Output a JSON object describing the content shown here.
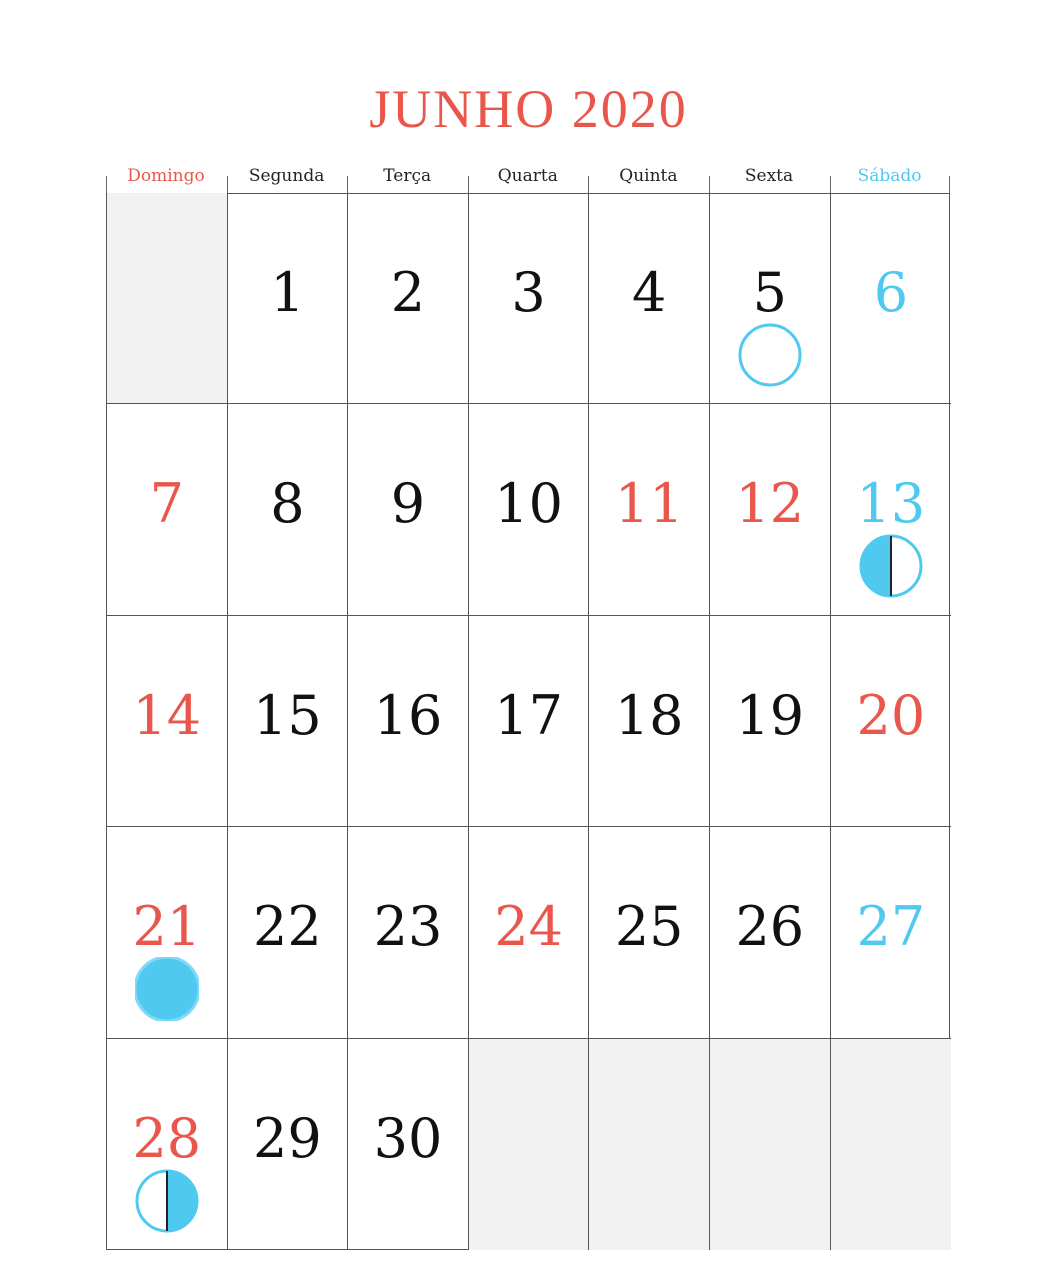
{
  "title": "JUNHO 2020",
  "colors": {
    "red": "#e9564b",
    "blue": "#4fc9f0",
    "blank": "#f1f1f1"
  },
  "weekdays": [
    {
      "label": "Domingo",
      "style": "sun"
    },
    {
      "label": "Segunda",
      "style": ""
    },
    {
      "label": "Terça",
      "style": ""
    },
    {
      "label": "Quarta",
      "style": ""
    },
    {
      "label": "Quinta",
      "style": ""
    },
    {
      "label": "Sexta",
      "style": ""
    },
    {
      "label": "Sábado",
      "style": "sat"
    }
  ],
  "weeks": [
    [
      null,
      {
        "day": "1",
        "color": "black"
      },
      {
        "day": "2",
        "color": "black"
      },
      {
        "day": "3",
        "color": "black"
      },
      {
        "day": "4",
        "color": "black"
      },
      {
        "day": "5",
        "color": "black",
        "moon": "full-moon-icon"
      },
      {
        "day": "6",
        "color": "blue"
      }
    ],
    [
      {
        "day": "7",
        "color": "red"
      },
      {
        "day": "8",
        "color": "black"
      },
      {
        "day": "9",
        "color": "black"
      },
      {
        "day": "10",
        "color": "black"
      },
      {
        "day": "11",
        "color": "red"
      },
      {
        "day": "12",
        "color": "red"
      },
      {
        "day": "13",
        "color": "blue",
        "moon": "last-quarter-moon-icon"
      }
    ],
    [
      {
        "day": "14",
        "color": "red"
      },
      {
        "day": "15",
        "color": "black"
      },
      {
        "day": "16",
        "color": "black"
      },
      {
        "day": "17",
        "color": "black"
      },
      {
        "day": "18",
        "color": "black"
      },
      {
        "day": "19",
        "color": "black"
      },
      {
        "day": "20",
        "color": "red"
      }
    ],
    [
      {
        "day": "21",
        "color": "red",
        "moon": "new-moon-icon"
      },
      {
        "day": "22",
        "color": "black"
      },
      {
        "day": "23",
        "color": "black"
      },
      {
        "day": "24",
        "color": "red"
      },
      {
        "day": "25",
        "color": "black"
      },
      {
        "day": "26",
        "color": "black"
      },
      {
        "day": "27",
        "color": "blue"
      }
    ],
    [
      {
        "day": "28",
        "color": "red",
        "moon": "first-quarter-moon-icon"
      },
      {
        "day": "29",
        "color": "black"
      },
      {
        "day": "30",
        "color": "black"
      },
      null,
      null,
      null,
      null
    ]
  ]
}
